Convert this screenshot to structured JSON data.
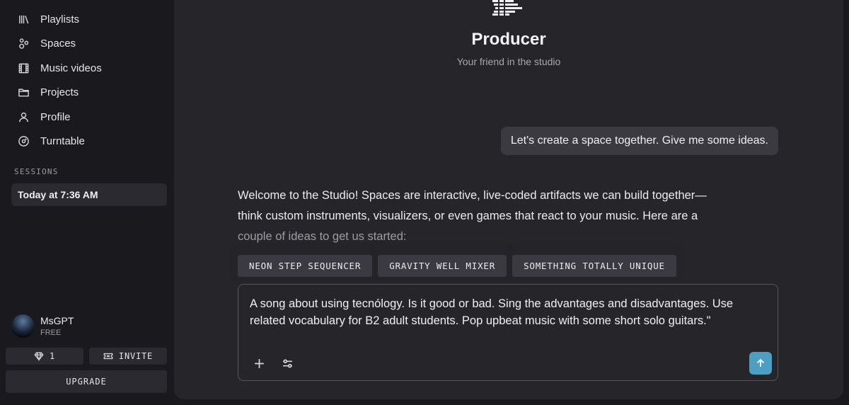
{
  "sidebar": {
    "nav": [
      {
        "label": "Playlists",
        "icon": "library-icon"
      },
      {
        "label": "Spaces",
        "icon": "spaces-icon"
      },
      {
        "label": "Music videos",
        "icon": "film-icon"
      },
      {
        "label": "Projects",
        "icon": "folder-icon"
      },
      {
        "label": "Profile",
        "icon": "user-icon"
      },
      {
        "label": "Turntable",
        "icon": "vinyl-icon"
      }
    ],
    "sessions_heading": "SESSIONS",
    "sessions": [
      {
        "label": "Today at 7:36 AM"
      }
    ],
    "user": {
      "name": "MsGPT",
      "plan": "FREE"
    },
    "gems_count": "1",
    "invite_label": "INVITE",
    "upgrade_label": "UPGRADE"
  },
  "main": {
    "title": "Producer",
    "subtitle": "Your friend in the studio",
    "user_message": "Let's create a space together. Give me some ideas.",
    "reply_lines": [
      "Welcome to the Studio! Spaces are interactive, live-coded artifacts we can build together—",
      "think custom instruments, visualizers, or even games that react to your music. Here are a",
      "couple of ideas to get us started:"
    ],
    "chips": [
      "NEON STEP SEQUENCER",
      "GRAVITY WELL MIXER",
      "SOMETHING TOTALLY UNIQUE"
    ],
    "composer": {
      "value": "A song about using tecnólogy. Is it good or bad. Sing the advantages and disadvantages. Use related vocabulary for B2 adult students. Pop upbeat music with some short solo guitars.\""
    }
  },
  "colors": {
    "sidebar_bg": "#1a1a1e",
    "main_bg": "#26262a",
    "bubble_bg": "#3a3a40",
    "send_button": "#4a9fc2"
  }
}
